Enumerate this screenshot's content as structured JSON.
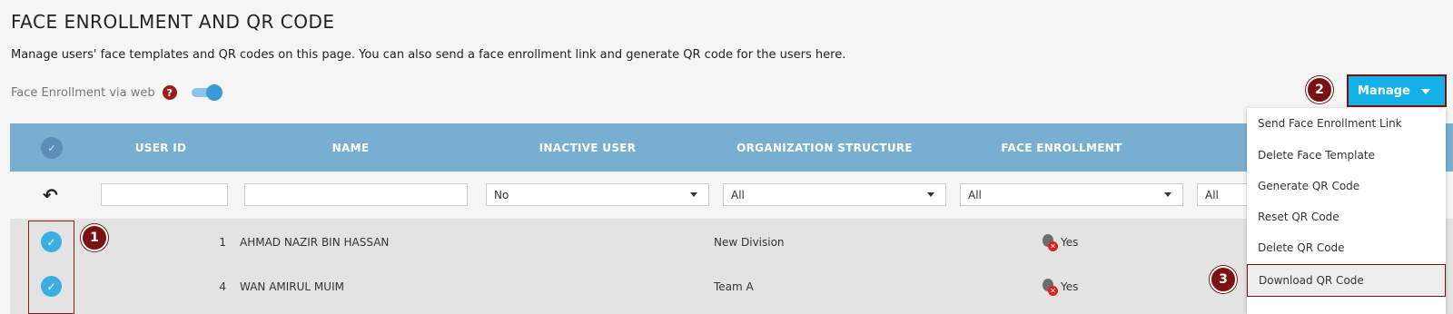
{
  "page": {
    "title": "FACE ENROLLMENT AND QR CODE",
    "description": "Manage users' face templates and QR codes on this page. You can also send a face enrollment link and generate QR code for the users here."
  },
  "face_enrollment_web": {
    "label": "Face Enrollment via web",
    "help": "?",
    "toggle_on": true
  },
  "manage": {
    "label": "Manage",
    "menu": [
      "Send Face Enrollment Link",
      "Delete Face Template",
      "Generate QR Code",
      "Reset QR Code",
      "Delete QR Code",
      "Download QR Code"
    ]
  },
  "table": {
    "columns": [
      "USER ID",
      "NAME",
      "INACTIVE USER",
      "ORGANIZATION STRUCTURE",
      "FACE ENROLLMENT"
    ],
    "filters": {
      "inactive_user": "No",
      "organization_structure": "All",
      "face_enrollment": "All",
      "extra": "All"
    },
    "rows": [
      {
        "user_id": "1",
        "name": "AHMAD NAZIR BIN HASSAN",
        "organization": "New Division",
        "face_enrollment": "Yes"
      },
      {
        "user_id": "4",
        "name": "WAN AMIRUL MUIM",
        "organization": "Team A",
        "face_enrollment": "Yes"
      }
    ]
  },
  "callouts": [
    "1",
    "2",
    "3"
  ],
  "colors": {
    "header_bg": "#78aed0",
    "manage_btn": "#14b1e8",
    "callout": "#7a1212",
    "row_bg": "#e3e3e3"
  }
}
